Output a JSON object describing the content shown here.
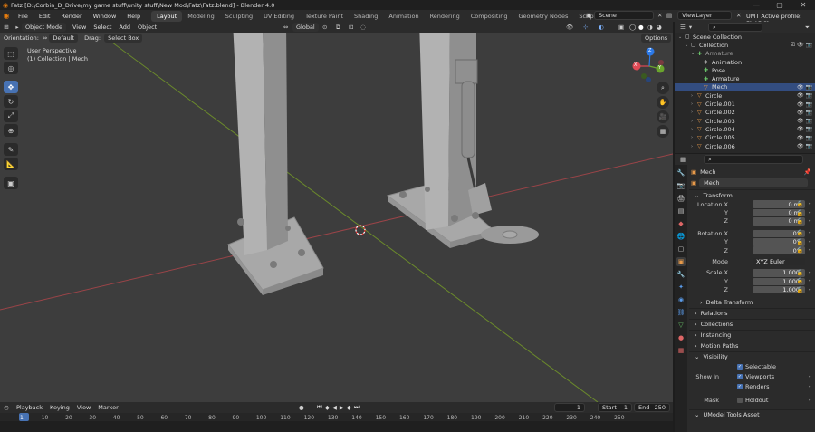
{
  "window": {
    "title": "Fatz [D:\\Corbin_D_Drive\\my game stuff\\unity stuff\\New Mod\\Fatz\\Fatz.blend] - Blender 4.0",
    "min": "—",
    "max": "▢",
    "close": "✕"
  },
  "menu": [
    "File",
    "Edit",
    "Render",
    "Window",
    "Help"
  ],
  "workspaces": [
    "Layout",
    "Modeling",
    "Sculpting",
    "UV Editing",
    "Texture Paint",
    "Shading",
    "Animation",
    "Rendering",
    "Compositing",
    "Geometry Nodes",
    "Scripting"
  ],
  "workspace_add": "+",
  "scene": "Scene",
  "view_layer": "ViewLayer",
  "addon_status": "UMT Active profile: FNAF Sb",
  "viewport_header": {
    "mode": "Object Mode",
    "menus": [
      "View",
      "Select",
      "Add",
      "Object"
    ],
    "transform": "Global",
    "options": "Options"
  },
  "viewport_header2": {
    "orientation_label": "Orientation:",
    "orientation": "Default",
    "drag_label": "Drag:",
    "drag": "Select Box"
  },
  "viewport_overlay": {
    "view_name": "User Perspective",
    "collection": "(1) Collection | Mech"
  },
  "gizmo": {
    "x": "X",
    "y": "Y",
    "z": "Z"
  },
  "timeline": {
    "menus": [
      "Playback",
      "Keying",
      "View",
      "Marker"
    ],
    "current_frame": "1",
    "start_label": "Start",
    "start": "1",
    "end_label": "End",
    "end": "250",
    "ruler": [
      "1",
      "10",
      "20",
      "30",
      "40",
      "50",
      "60",
      "70",
      "80",
      "90",
      "100",
      "110",
      "120",
      "130",
      "140",
      "150",
      "160",
      "170",
      "180",
      "190",
      "200",
      "210",
      "220",
      "230",
      "240",
      "250"
    ]
  },
  "outliner": {
    "rows": [
      {
        "label": "Scene Collection",
        "indent": 0
      },
      {
        "label": "Collection",
        "indent": 1
      },
      {
        "label": "Armature",
        "indent": 2,
        "dim": true
      },
      {
        "label": "Animation",
        "indent": 3
      },
      {
        "label": "Pose",
        "indent": 3
      },
      {
        "label": "Armature",
        "indent": 3
      },
      {
        "label": "Mech",
        "indent": 3,
        "selected": true
      },
      {
        "label": "Circle",
        "indent": 2
      },
      {
        "label": "Circle.001",
        "indent": 2
      },
      {
        "label": "Circle.002",
        "indent": 2
      },
      {
        "label": "Circle.003",
        "indent": 2
      },
      {
        "label": "Circle.004",
        "indent": 2
      },
      {
        "label": "Circle.005",
        "indent": 2
      },
      {
        "label": "Circle.006",
        "indent": 2
      }
    ]
  },
  "properties": {
    "object_name_header": "Mech",
    "object_name_field": "Mech",
    "transform_title": "Transform",
    "location_label": "Location X",
    "loc_x": "0 m",
    "loc_y": "0 m",
    "loc_z": "0 m",
    "rotation_label": "Rotation X",
    "rot_x": "0°",
    "rot_y": "0°",
    "rot_z": "0°",
    "y_label": "Y",
    "z_label": "Z",
    "mode_label": "Mode",
    "mode": "XYZ Euler",
    "scale_label": "Scale X",
    "scale_x": "1.000",
    "scale_y": "1.000",
    "scale_z": "1.000",
    "delta": "Delta Transform",
    "panels": [
      "Relations",
      "Collections",
      "Instancing",
      "Motion Paths"
    ],
    "visibility": "Visibility",
    "selectable": "Selectable",
    "show_in": "Show In",
    "viewports": "Viewports",
    "renders": "Renders",
    "mask": "Mask",
    "holdout": "Holdout",
    "umodel": "UModel Tools Asset"
  }
}
